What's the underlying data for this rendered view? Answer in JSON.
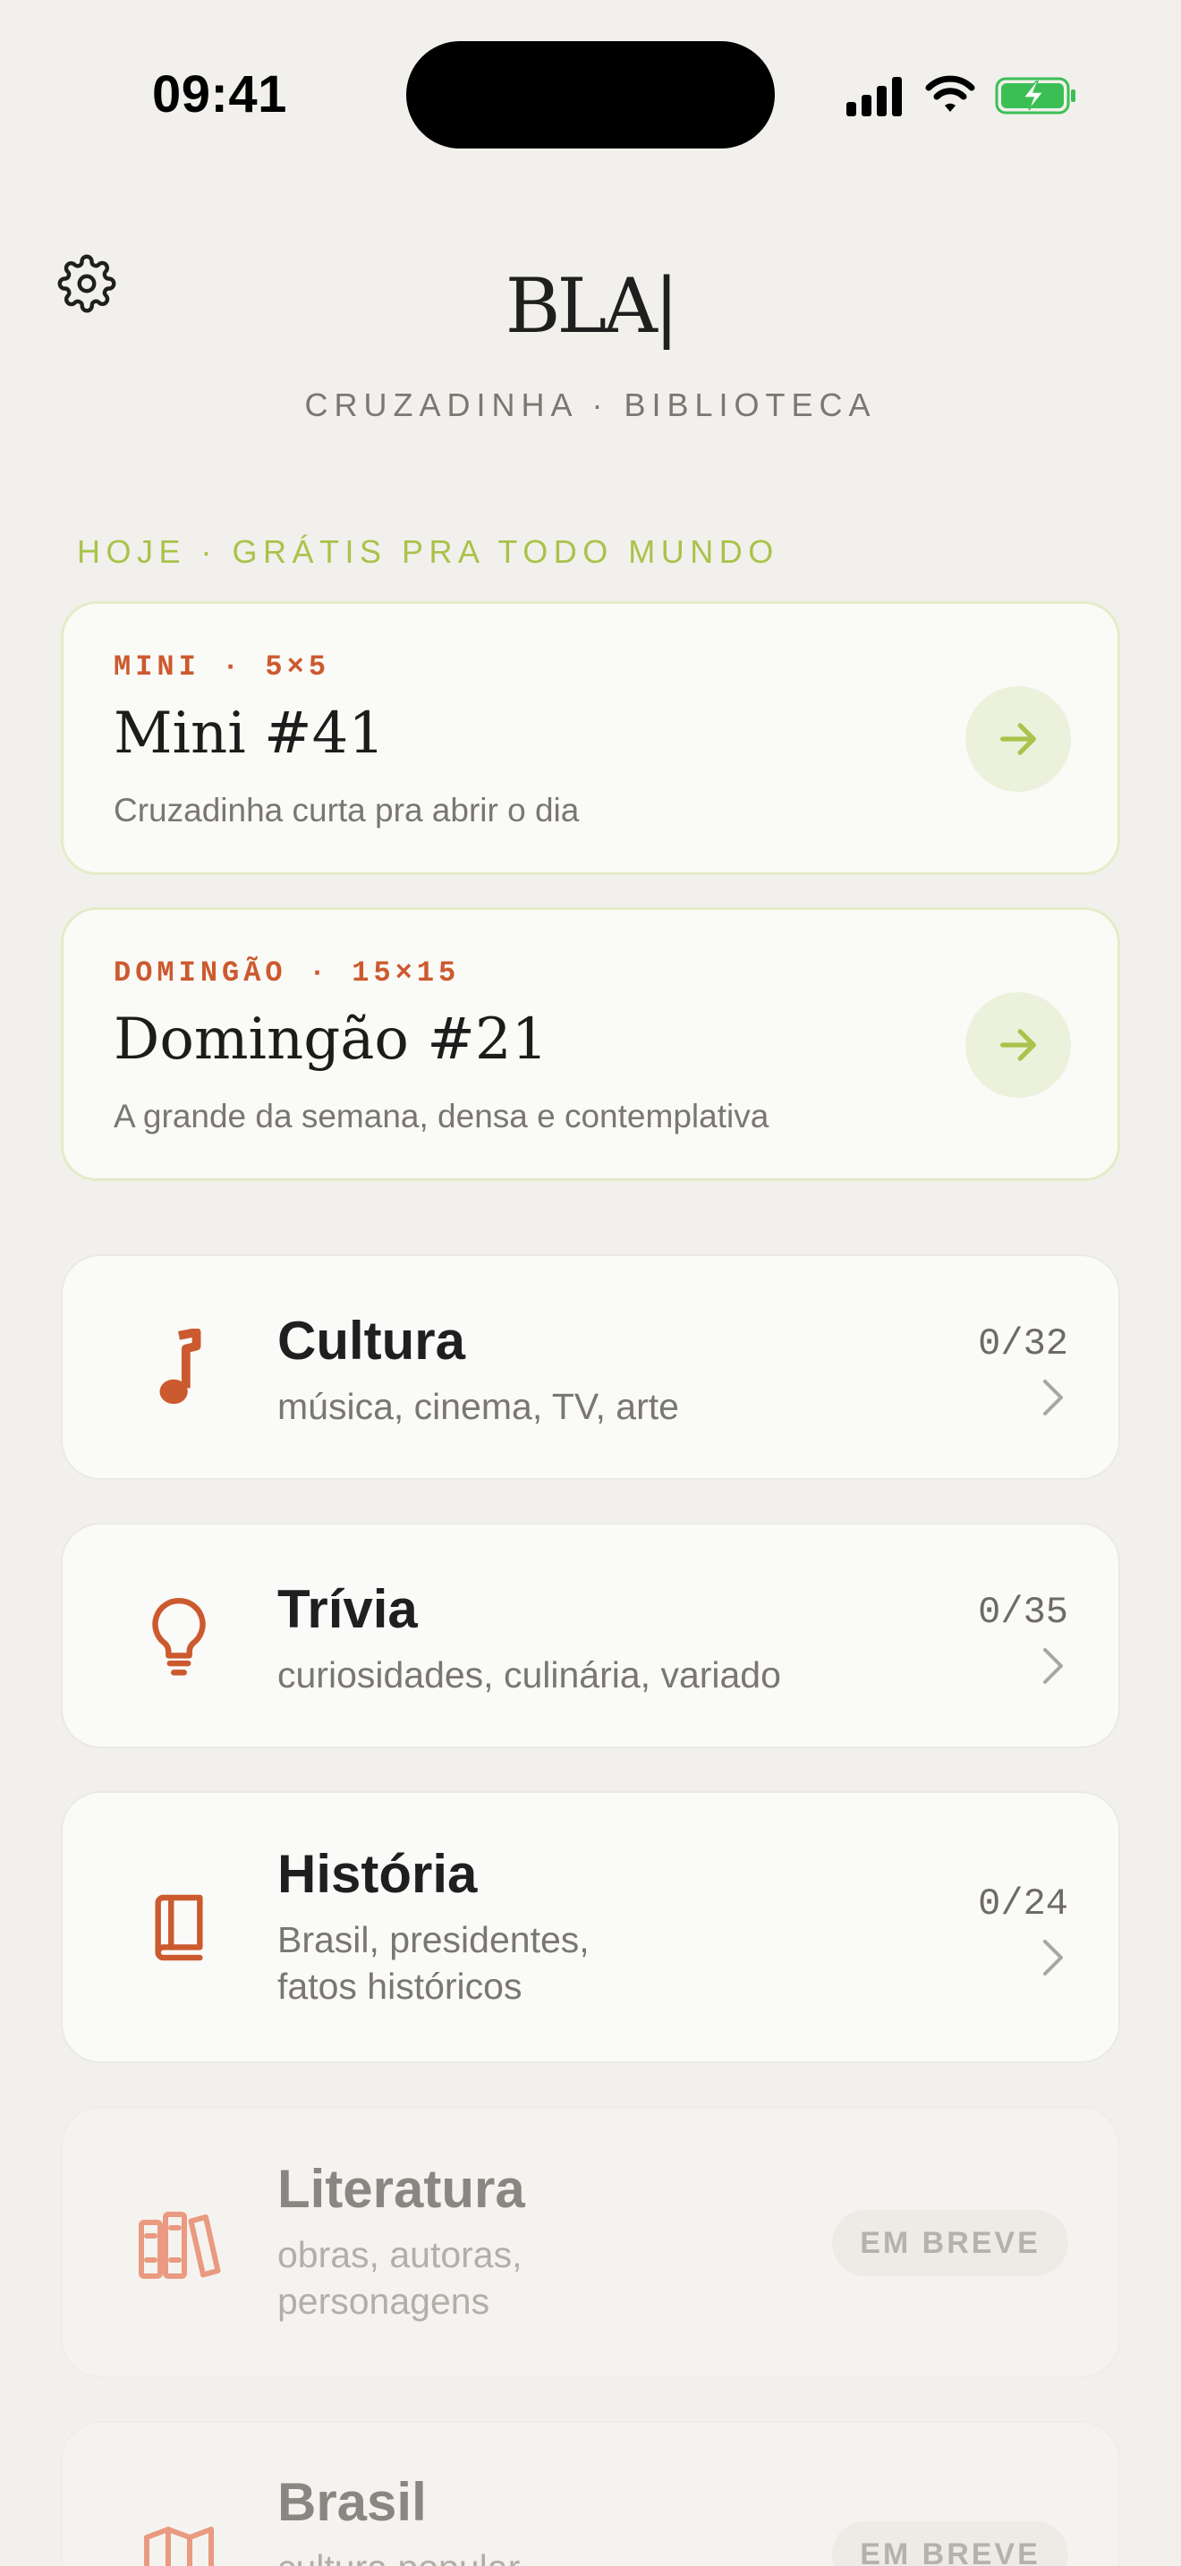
{
  "status_bar": {
    "time": "09:41"
  },
  "header": {
    "logo": "BLA|",
    "subtitle": "CRUZADINHA · BIBLIOTECA"
  },
  "today": {
    "label": "HOJE · GRÁTIS PRA TODO MUNDO",
    "cards": [
      {
        "eyebrow": "MINI · 5×5",
        "title": "Mini #41",
        "description": "Cruzadinha curta pra abrir o dia"
      },
      {
        "eyebrow": "DOMINGÃO · 15×15",
        "title": "Domingão #21",
        "description": "A grande da semana, densa e contemplativa"
      }
    ]
  },
  "categories": [
    {
      "icon": "music-note-icon",
      "title": "Cultura",
      "description": "música, cinema, TV, arte",
      "count": "0/32"
    },
    {
      "icon": "lightbulb-icon",
      "title": "Trívia",
      "description": "curiosidades, culinária, variado",
      "count": "0/35"
    },
    {
      "icon": "book-icon",
      "title": "História",
      "description_lines": [
        "Brasil, presidentes,",
        "fatos históricos"
      ],
      "count": "0/24"
    },
    {
      "icon": "books-icon",
      "title": "Literatura",
      "description_lines": [
        "obras, autoras,",
        "personagens"
      ],
      "badge": "EM BREVE"
    },
    {
      "icon": "map-icon",
      "title": "Brasil",
      "description": "cultura popular",
      "badge": "EM BREVE"
    }
  ],
  "colors": {
    "accent_green": "#a9c34b",
    "accent_orange": "#cc5a2f",
    "background": "#f2f0ec"
  }
}
